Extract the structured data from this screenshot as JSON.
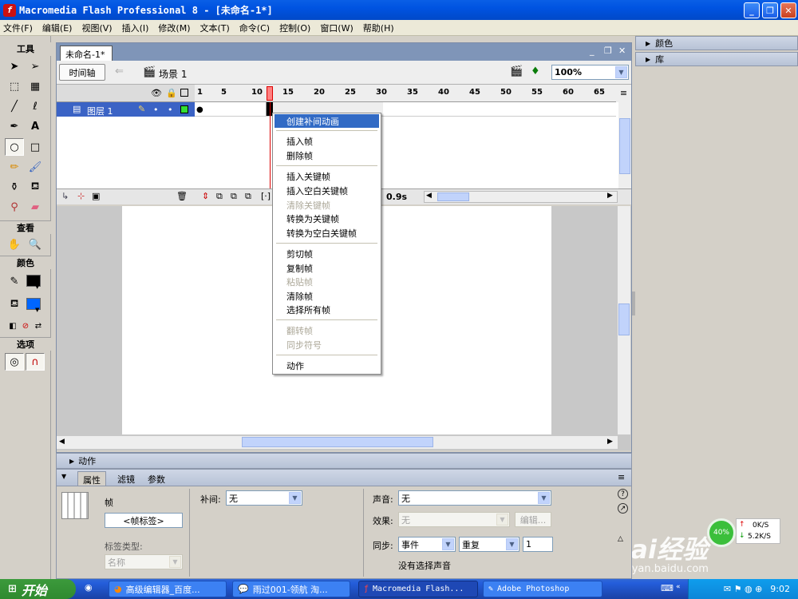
{
  "window": {
    "title": "Macromedia Flash Professional 8 - [未命名-1*]",
    "controls": [
      "minimize",
      "restore",
      "close"
    ]
  },
  "menubar": [
    "文件(F)",
    "编辑(E)",
    "视图(V)",
    "插入(I)",
    "修改(M)",
    "文本(T)",
    "命令(C)",
    "控制(O)",
    "窗口(W)",
    "帮助(H)"
  ],
  "tools": {
    "title": "工具",
    "view_title": "查看",
    "color_title": "颜色",
    "options_title": "选项",
    "stroke_color": "#000000",
    "fill_color": "#0066ff"
  },
  "document": {
    "tab": "未命名-1*",
    "timeline_button": "时间轴",
    "scene": "场景 1",
    "zoom": "100%"
  },
  "timeline": {
    "ruler_labels": [
      "1",
      "5",
      "10",
      "15",
      "20",
      "25",
      "30",
      "35",
      "40",
      "45",
      "50",
      "55",
      "60",
      "65"
    ],
    "layer_name": "图层 1",
    "current_frame": 12,
    "elapsed_time": "0.9s"
  },
  "context_menu": {
    "items": [
      {
        "label": "创建补间动画",
        "state": "highlighted"
      },
      {
        "label": "插入帧",
        "state": "enabled"
      },
      {
        "label": "删除帧",
        "state": "enabled"
      },
      {
        "label": "插入关键帧",
        "state": "enabled"
      },
      {
        "label": "插入空白关键帧",
        "state": "enabled"
      },
      {
        "label": "清除关键帧",
        "state": "disabled"
      },
      {
        "label": "转换为关键帧",
        "state": "enabled"
      },
      {
        "label": "转换为空白关键帧",
        "state": "enabled"
      },
      {
        "label": "剪切帧",
        "state": "enabled"
      },
      {
        "label": "复制帧",
        "state": "enabled"
      },
      {
        "label": "粘贴帧",
        "state": "disabled"
      },
      {
        "label": "清除帧",
        "state": "enabled"
      },
      {
        "label": "选择所有帧",
        "state": "enabled"
      },
      {
        "label": "翻转帧",
        "state": "disabled"
      },
      {
        "label": "同步符号",
        "state": "disabled"
      },
      {
        "label": "动作",
        "state": "enabled"
      }
    ]
  },
  "panels": {
    "color": "颜色",
    "library": "库",
    "actions": "动作"
  },
  "properties": {
    "tabs": [
      "属性",
      "滤镜",
      "参数"
    ],
    "frame_label": "帧",
    "frame_label_placeholder": "<帧标签>",
    "label_type_label": "标签类型:",
    "label_type_value": "名称",
    "tween_label": "补间:",
    "tween_value": "无",
    "sound_label": "声音:",
    "sound_value": "无",
    "effect_label": "效果:",
    "effect_value": "无",
    "edit_button": "编辑...",
    "sync_label": "同步:",
    "sync_value": "事件",
    "repeat_value": "重复",
    "repeat_count": "1",
    "no_sound": "没有选择声音"
  },
  "taskbar": {
    "start": "开始",
    "tasks": [
      {
        "label": "高级编辑器_百度...",
        "active": false
      },
      {
        "label": "雨过001-领航 淘...",
        "active": false
      },
      {
        "label": "Macromedia Flash...",
        "active": true
      },
      {
        "label": "Adobe Photoshop",
        "active": false
      }
    ],
    "time": "9:02",
    "net_percent": "40%",
    "net_up": "0K/S",
    "net_down": "5.2K/S"
  },
  "watermark": {
    "brand": "Bai经验",
    "url": "jingyan.baidu.com"
  }
}
